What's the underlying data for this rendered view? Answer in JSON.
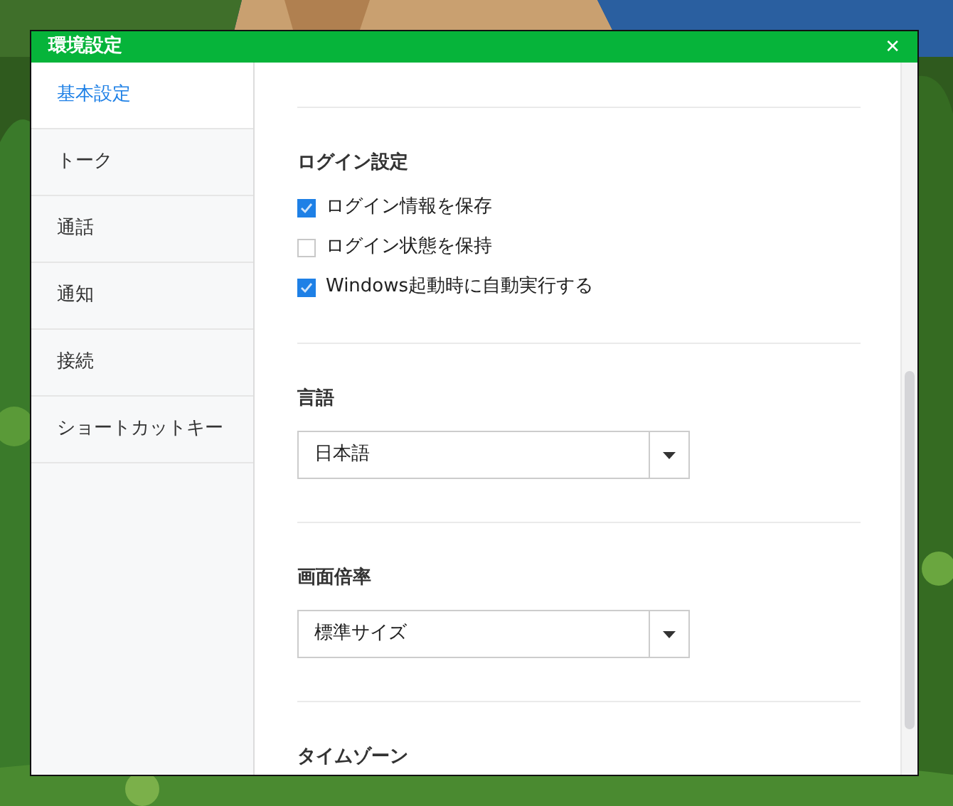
{
  "window": {
    "title": "環境設定",
    "close": "✕"
  },
  "sidebar": {
    "items": [
      {
        "label": "基本設定",
        "selected": true
      },
      {
        "label": "トーク",
        "selected": false
      },
      {
        "label": "通話",
        "selected": false
      },
      {
        "label": "通知",
        "selected": false
      },
      {
        "label": "接続",
        "selected": false
      },
      {
        "label": "ショートカットキー",
        "selected": false
      }
    ]
  },
  "sections": [
    {
      "kind": "checks",
      "title": "ログイン設定",
      "options": [
        {
          "label": "ログイン情報を保存",
          "checked": true
        },
        {
          "label": "ログイン状態を保持",
          "checked": false
        },
        {
          "label": "Windows起動時に自動実行する",
          "checked": true
        }
      ]
    },
    {
      "kind": "select",
      "title": "言語",
      "value": "日本語"
    },
    {
      "kind": "select",
      "title": "画面倍率",
      "value": "標準サイズ"
    },
    {
      "kind": "heading",
      "title": "タイムゾーン"
    }
  ]
}
